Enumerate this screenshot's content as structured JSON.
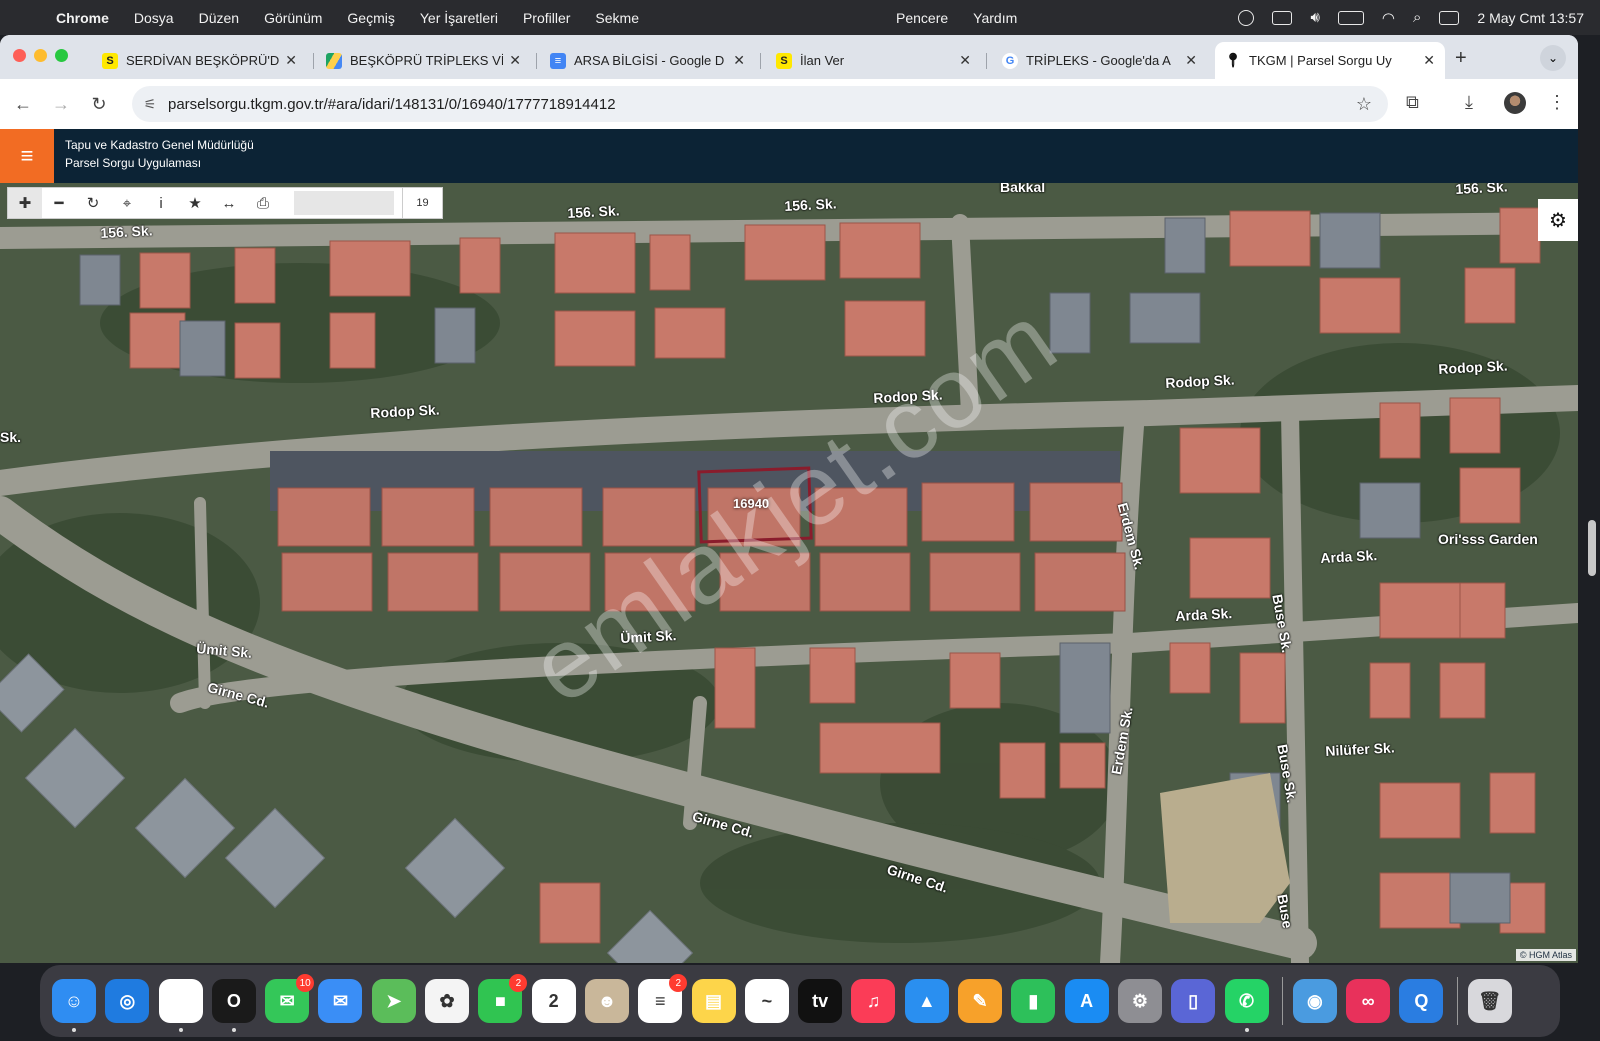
{
  "menubar": {
    "app": "Chrome",
    "items": [
      "Dosya",
      "Düzen",
      "Görünüm",
      "Geçmiş",
      "Yer İşaretleri",
      "Profiller",
      "Sekme"
    ],
    "right_items": [
      "Pencere",
      "Yardım"
    ],
    "clock": "2 May Cmt  13:57"
  },
  "tabs": [
    {
      "title": "SERDİVAN BEŞKÖPRÜ'D",
      "icon": "sahibinden-icon"
    },
    {
      "title": "BEŞKÖPRÜ TRİPLEKS Vİ",
      "icon": "google-drive-icon"
    },
    {
      "title": "ARSA BİLGİSİ - Google D",
      "icon": "google-docs-icon"
    },
    {
      "title": "İlan Ver",
      "icon": "sahibinden-icon"
    },
    {
      "title": "TRİPLEKS - Google'da A",
      "icon": "google-icon"
    },
    {
      "title": "TKGM | Parsel Sorgu Uy",
      "icon": "map-pin-icon"
    }
  ],
  "url": "parselsorgu.tkgm.gov.tr/#ara/idari/148131/0/16940/1777718914412",
  "app_header": {
    "line1": "Tapu ve Kadastro Genel Müdürlüğü",
    "line2": "Parsel Sorgu Uygulaması"
  },
  "map": {
    "zoom_level": "19",
    "parcel_number": "16940",
    "attribution": "© HGM Atlas",
    "watermark": "emlakjet.com",
    "labels": {
      "s156a": "156. Sk.",
      "s156b": "156. Sk.",
      "s156c": "156. Sk.",
      "s156d": "156. Sk.",
      "rodop1": "Rodop Sk.",
      "rodop2": "Rodop Sk.",
      "rodop3": "Rodop Sk.",
      "rodop4": "Rodop Sk.",
      "sk": "Sk.",
      "erdem1": "Erdem Sk.",
      "erdem2": "Erdem Sk.",
      "umit1": "Ümit Sk.",
      "umit2": "Ümit Sk.",
      "girne1": "Girne Cd.",
      "girne2": "Girne Cd.",
      "girne3": "Girne Cd.",
      "arda1": "Arda Sk.",
      "arda2": "Arda Sk.",
      "buse1": "Buse Sk.",
      "buse2": "Buse Sk.",
      "buse3": "Buse",
      "nilufer": "Nilüfer Sk.",
      "garden": "Ori'sss Garden",
      "bakkal": "Bakkal"
    }
  },
  "dock": [
    {
      "name": "finder",
      "color": "#2f8df2",
      "label": "☺"
    },
    {
      "name": "safari",
      "color": "#1f7be0",
      "label": "◎"
    },
    {
      "name": "chrome",
      "color": "#fff",
      "label": ""
    },
    {
      "name": "opera",
      "color": "#1a1a1a",
      "label": "O"
    },
    {
      "name": "messages",
      "color": "#34c759",
      "label": "✉",
      "badge": "10"
    },
    {
      "name": "mail",
      "color": "#3a8ef6",
      "label": "✉"
    },
    {
      "name": "maps",
      "color": "#5bbd5a",
      "label": "➤"
    },
    {
      "name": "photos",
      "color": "#f4f4f4",
      "label": "✿"
    },
    {
      "name": "facetime",
      "color": "#30c451",
      "label": "■",
      "badge": "2"
    },
    {
      "name": "calendar",
      "color": "#fff",
      "label": "2"
    },
    {
      "name": "contacts",
      "color": "#c9b79a",
      "label": "☻"
    },
    {
      "name": "reminders",
      "color": "#fff",
      "label": "≡",
      "badge": "2"
    },
    {
      "name": "notes",
      "color": "#fdd54a",
      "label": "▤"
    },
    {
      "name": "freeform",
      "color": "#fff",
      "label": "~"
    },
    {
      "name": "apple-tv",
      "color": "#111",
      "label": "tv"
    },
    {
      "name": "music",
      "color": "#fb3c57",
      "label": "♫"
    },
    {
      "name": "keynote",
      "color": "#2a8ff0",
      "label": "▲"
    },
    {
      "name": "pages",
      "color": "#f7a12a",
      "label": "✎"
    },
    {
      "name": "numbers",
      "color": "#2dc05a",
      "label": "▮"
    },
    {
      "name": "app-store",
      "color": "#1a8cf3",
      "label": "A"
    },
    {
      "name": "system-settings",
      "color": "#8e8e93",
      "label": "⚙"
    },
    {
      "name": "simulator",
      "color": "#5a66d6",
      "label": "▯"
    },
    {
      "name": "whatsapp",
      "color": "#25d366",
      "label": "✆"
    },
    {
      "name": "disk-utility",
      "color": "#4a9be0",
      "label": "◉"
    },
    {
      "name": "creative-cloud",
      "color": "#e8315b",
      "label": "∞"
    },
    {
      "name": "quicktime",
      "color": "#2a7de1",
      "label": "Q"
    },
    {
      "name": "trash",
      "color": "#d8d8dc",
      "label": "🗑"
    }
  ]
}
